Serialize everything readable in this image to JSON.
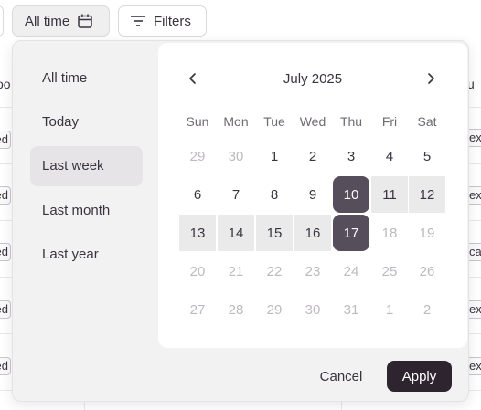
{
  "toolbar": {
    "date_filter_label": "All time",
    "filters_label": "Filters"
  },
  "background": {
    "header_left": "oo",
    "header_right": "u",
    "left_labels": [
      "ed",
      "ed",
      "ed",
      "ed",
      "ed"
    ],
    "right_labels": [
      "ex",
      "ex",
      "car",
      "ex",
      "ex"
    ]
  },
  "presets": [
    {
      "label": "All time",
      "active": false
    },
    {
      "label": "Today",
      "active": false
    },
    {
      "label": "Last week",
      "active": true
    },
    {
      "label": "Last month",
      "active": false
    },
    {
      "label": "Last year",
      "active": false
    }
  ],
  "calendar": {
    "month_label": "July 2025",
    "weekdays": [
      "Sun",
      "Mon",
      "Tue",
      "Wed",
      "Thu",
      "Fri",
      "Sat"
    ],
    "weeks": [
      [
        {
          "d": "29",
          "m": true
        },
        {
          "d": "30",
          "m": true
        },
        {
          "d": "1"
        },
        {
          "d": "2"
        },
        {
          "d": "3"
        },
        {
          "d": "4"
        },
        {
          "d": "5"
        }
      ],
      [
        {
          "d": "6"
        },
        {
          "d": "7"
        },
        {
          "d": "8"
        },
        {
          "d": "9"
        },
        {
          "d": "10",
          "s": "edge"
        },
        {
          "d": "11",
          "s": "range"
        },
        {
          "d": "12",
          "s": "range"
        }
      ],
      [
        {
          "d": "13",
          "s": "range"
        },
        {
          "d": "14",
          "s": "range"
        },
        {
          "d": "15",
          "s": "range"
        },
        {
          "d": "16",
          "s": "range"
        },
        {
          "d": "17",
          "s": "edge"
        },
        {
          "d": "18",
          "m": true
        },
        {
          "d": "19",
          "m": true
        }
      ],
      [
        {
          "d": "20",
          "m": true
        },
        {
          "d": "21",
          "m": true
        },
        {
          "d": "22",
          "m": true
        },
        {
          "d": "23",
          "m": true
        },
        {
          "d": "24",
          "m": true
        },
        {
          "d": "25",
          "m": true
        },
        {
          "d": "26",
          "m": true
        }
      ],
      [
        {
          "d": "27",
          "m": true
        },
        {
          "d": "28",
          "m": true
        },
        {
          "d": "29",
          "m": true
        },
        {
          "d": "30",
          "m": true
        },
        {
          "d": "31",
          "m": true
        },
        {
          "d": "1",
          "m": true
        },
        {
          "d": "2",
          "m": true
        }
      ]
    ],
    "range_start": "10",
    "range_end": "17"
  },
  "actions": {
    "cancel_label": "Cancel",
    "apply_label": "Apply"
  },
  "colors": {
    "accent": "#2e2430",
    "range_edge": "#574e5b",
    "range_fill": "#ebeaeb"
  },
  "icons": {
    "date_filter": "calendar-icon",
    "filters": "filter-lines-icon",
    "prev": "chevron-left-icon",
    "next": "chevron-right-icon"
  }
}
